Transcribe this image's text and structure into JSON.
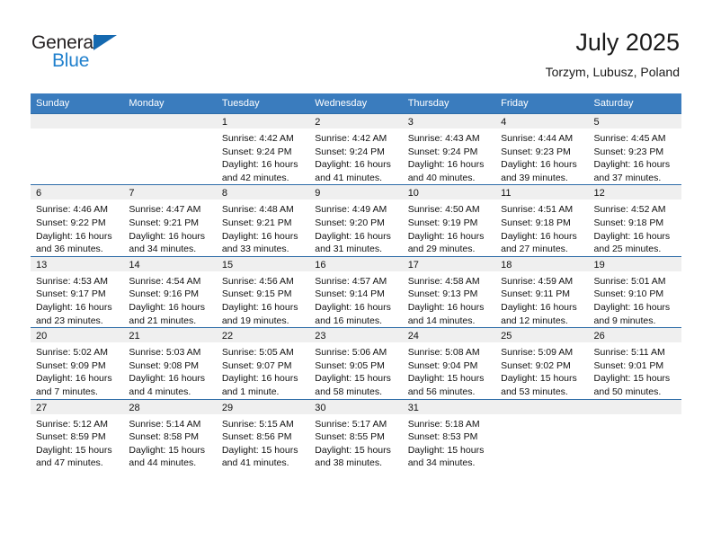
{
  "brand": {
    "name_part1": "General",
    "name_part2": "Blue",
    "triangle_icon": "triangle-icon",
    "color_dark": "#231f20",
    "color_blue": "#2080cd"
  },
  "header": {
    "title": "July 2025",
    "subtitle": "Torzym, Lubusz, Poland"
  },
  "theme": {
    "header_bg": "#3a7cbe",
    "row_divider": "#2e6da8",
    "daynum_bg": "#efefef"
  },
  "weekdays": [
    "Sunday",
    "Monday",
    "Tuesday",
    "Wednesday",
    "Thursday",
    "Friday",
    "Saturday"
  ],
  "weeks": [
    [
      {
        "day": "",
        "lines": []
      },
      {
        "day": "",
        "lines": []
      },
      {
        "day": "1",
        "lines": [
          "Sunrise: 4:42 AM",
          "Sunset: 9:24 PM",
          "Daylight: 16 hours",
          "and 42 minutes."
        ]
      },
      {
        "day": "2",
        "lines": [
          "Sunrise: 4:42 AM",
          "Sunset: 9:24 PM",
          "Daylight: 16 hours",
          "and 41 minutes."
        ]
      },
      {
        "day": "3",
        "lines": [
          "Sunrise: 4:43 AM",
          "Sunset: 9:24 PM",
          "Daylight: 16 hours",
          "and 40 minutes."
        ]
      },
      {
        "day": "4",
        "lines": [
          "Sunrise: 4:44 AM",
          "Sunset: 9:23 PM",
          "Daylight: 16 hours",
          "and 39 minutes."
        ]
      },
      {
        "day": "5",
        "lines": [
          "Sunrise: 4:45 AM",
          "Sunset: 9:23 PM",
          "Daylight: 16 hours",
          "and 37 minutes."
        ]
      }
    ],
    [
      {
        "day": "6",
        "lines": [
          "Sunrise: 4:46 AM",
          "Sunset: 9:22 PM",
          "Daylight: 16 hours",
          "and 36 minutes."
        ]
      },
      {
        "day": "7",
        "lines": [
          "Sunrise: 4:47 AM",
          "Sunset: 9:21 PM",
          "Daylight: 16 hours",
          "and 34 minutes."
        ]
      },
      {
        "day": "8",
        "lines": [
          "Sunrise: 4:48 AM",
          "Sunset: 9:21 PM",
          "Daylight: 16 hours",
          "and 33 minutes."
        ]
      },
      {
        "day": "9",
        "lines": [
          "Sunrise: 4:49 AM",
          "Sunset: 9:20 PM",
          "Daylight: 16 hours",
          "and 31 minutes."
        ]
      },
      {
        "day": "10",
        "lines": [
          "Sunrise: 4:50 AM",
          "Sunset: 9:19 PM",
          "Daylight: 16 hours",
          "and 29 minutes."
        ]
      },
      {
        "day": "11",
        "lines": [
          "Sunrise: 4:51 AM",
          "Sunset: 9:18 PM",
          "Daylight: 16 hours",
          "and 27 minutes."
        ]
      },
      {
        "day": "12",
        "lines": [
          "Sunrise: 4:52 AM",
          "Sunset: 9:18 PM",
          "Daylight: 16 hours",
          "and 25 minutes."
        ]
      }
    ],
    [
      {
        "day": "13",
        "lines": [
          "Sunrise: 4:53 AM",
          "Sunset: 9:17 PM",
          "Daylight: 16 hours",
          "and 23 minutes."
        ]
      },
      {
        "day": "14",
        "lines": [
          "Sunrise: 4:54 AM",
          "Sunset: 9:16 PM",
          "Daylight: 16 hours",
          "and 21 minutes."
        ]
      },
      {
        "day": "15",
        "lines": [
          "Sunrise: 4:56 AM",
          "Sunset: 9:15 PM",
          "Daylight: 16 hours",
          "and 19 minutes."
        ]
      },
      {
        "day": "16",
        "lines": [
          "Sunrise: 4:57 AM",
          "Sunset: 9:14 PM",
          "Daylight: 16 hours",
          "and 16 minutes."
        ]
      },
      {
        "day": "17",
        "lines": [
          "Sunrise: 4:58 AM",
          "Sunset: 9:13 PM",
          "Daylight: 16 hours",
          "and 14 minutes."
        ]
      },
      {
        "day": "18",
        "lines": [
          "Sunrise: 4:59 AM",
          "Sunset: 9:11 PM",
          "Daylight: 16 hours",
          "and 12 minutes."
        ]
      },
      {
        "day": "19",
        "lines": [
          "Sunrise: 5:01 AM",
          "Sunset: 9:10 PM",
          "Daylight: 16 hours",
          "and 9 minutes."
        ]
      }
    ],
    [
      {
        "day": "20",
        "lines": [
          "Sunrise: 5:02 AM",
          "Sunset: 9:09 PM",
          "Daylight: 16 hours",
          "and 7 minutes."
        ]
      },
      {
        "day": "21",
        "lines": [
          "Sunrise: 5:03 AM",
          "Sunset: 9:08 PM",
          "Daylight: 16 hours",
          "and 4 minutes."
        ]
      },
      {
        "day": "22",
        "lines": [
          "Sunrise: 5:05 AM",
          "Sunset: 9:07 PM",
          "Daylight: 16 hours",
          "and 1 minute."
        ]
      },
      {
        "day": "23",
        "lines": [
          "Sunrise: 5:06 AM",
          "Sunset: 9:05 PM",
          "Daylight: 15 hours",
          "and 58 minutes."
        ]
      },
      {
        "day": "24",
        "lines": [
          "Sunrise: 5:08 AM",
          "Sunset: 9:04 PM",
          "Daylight: 15 hours",
          "and 56 minutes."
        ]
      },
      {
        "day": "25",
        "lines": [
          "Sunrise: 5:09 AM",
          "Sunset: 9:02 PM",
          "Daylight: 15 hours",
          "and 53 minutes."
        ]
      },
      {
        "day": "26",
        "lines": [
          "Sunrise: 5:11 AM",
          "Sunset: 9:01 PM",
          "Daylight: 15 hours",
          "and 50 minutes."
        ]
      }
    ],
    [
      {
        "day": "27",
        "lines": [
          "Sunrise: 5:12 AM",
          "Sunset: 8:59 PM",
          "Daylight: 15 hours",
          "and 47 minutes."
        ]
      },
      {
        "day": "28",
        "lines": [
          "Sunrise: 5:14 AM",
          "Sunset: 8:58 PM",
          "Daylight: 15 hours",
          "and 44 minutes."
        ]
      },
      {
        "day": "29",
        "lines": [
          "Sunrise: 5:15 AM",
          "Sunset: 8:56 PM",
          "Daylight: 15 hours",
          "and 41 minutes."
        ]
      },
      {
        "day": "30",
        "lines": [
          "Sunrise: 5:17 AM",
          "Sunset: 8:55 PM",
          "Daylight: 15 hours",
          "and 38 minutes."
        ]
      },
      {
        "day": "31",
        "lines": [
          "Sunrise: 5:18 AM",
          "Sunset: 8:53 PM",
          "Daylight: 15 hours",
          "and 34 minutes."
        ]
      },
      {
        "day": "",
        "lines": []
      },
      {
        "day": "",
        "lines": []
      }
    ]
  ]
}
